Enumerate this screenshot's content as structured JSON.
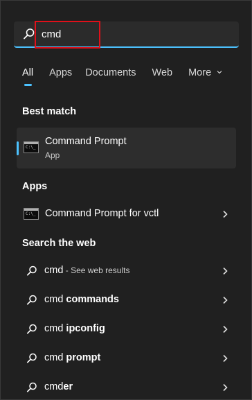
{
  "search": {
    "query": "cmd",
    "highlight_color": "#e0101a",
    "accent_color": "#4cc2ff"
  },
  "tabs": [
    {
      "label": "All",
      "active": true
    },
    {
      "label": "Apps",
      "active": false
    },
    {
      "label": "Documents",
      "active": false
    },
    {
      "label": "Web",
      "active": false
    },
    {
      "label": "More",
      "active": false
    }
  ],
  "best_match": {
    "heading": "Best match",
    "title": "Command Prompt",
    "subtitle": "App",
    "icon": "command-prompt-icon"
  },
  "apps": {
    "heading": "Apps",
    "items": [
      {
        "title": "Command Prompt for vctl",
        "icon": "command-prompt-icon"
      }
    ]
  },
  "web": {
    "heading": "Search the web",
    "items": [
      {
        "prefix": "cmd",
        "bold": "",
        "suffix": " - See web results"
      },
      {
        "prefix": "cmd ",
        "bold": "commands",
        "suffix": ""
      },
      {
        "prefix": "cmd ",
        "bold": "ipconfig",
        "suffix": ""
      },
      {
        "prefix": "cmd ",
        "bold": "prompt",
        "suffix": ""
      },
      {
        "prefix": "cmd",
        "bold": "er",
        "suffix": ""
      }
    ]
  }
}
